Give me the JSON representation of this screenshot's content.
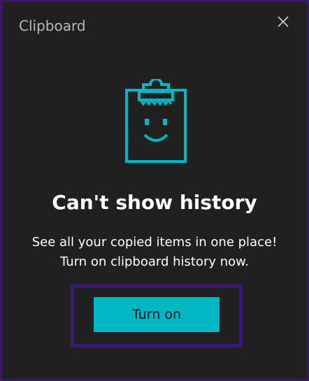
{
  "window": {
    "title": "Clipboard",
    "close_icon": "close-icon"
  },
  "illustration": {
    "icon": "clipboard-smiley-icon",
    "accent_color": "#00b7c3"
  },
  "main": {
    "heading": "Can't show history",
    "description_line1": "See all your copied items in one place!",
    "description_line2": "Turn on clipboard history now."
  },
  "actions": {
    "turn_on_label": "Turn on",
    "button_color": "#00b7c3",
    "highlight_color": "#3a1a78"
  }
}
